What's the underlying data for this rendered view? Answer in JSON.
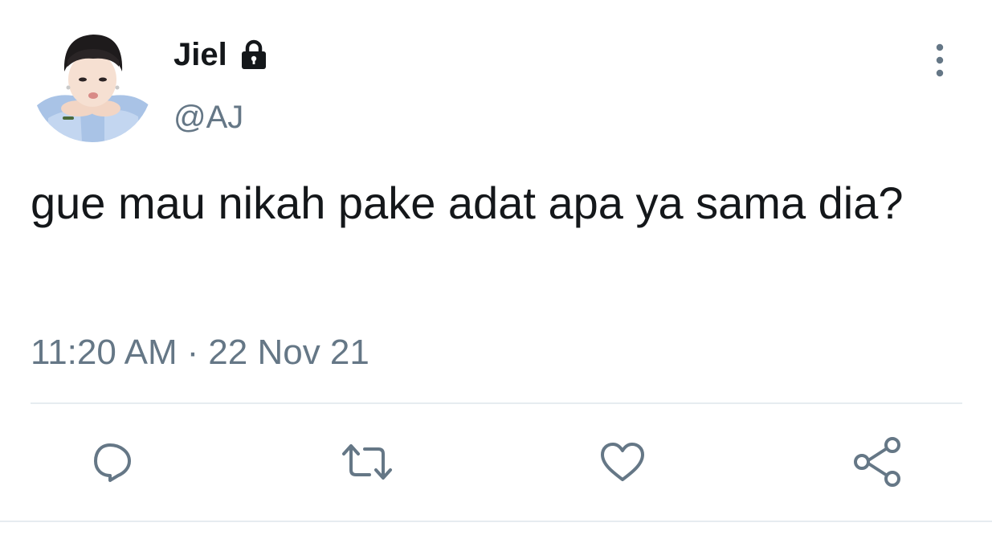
{
  "tweet": {
    "display_name": "Jiel",
    "handle": "@AJ",
    "text": "gue mau nikah pake adat apa ya sama dia?",
    "time": "11:20 AM",
    "separator": "·",
    "date": "22 Nov 21",
    "protected": true
  },
  "icons": {
    "lock": "lock-icon",
    "more": "more-vertical-icon",
    "reply": "reply-icon",
    "retweet": "retweet-icon",
    "like": "heart-icon",
    "share": "share-icon"
  },
  "colors": {
    "text_primary": "#14171a",
    "text_secondary": "#657786",
    "divider": "#e6ecf0"
  }
}
